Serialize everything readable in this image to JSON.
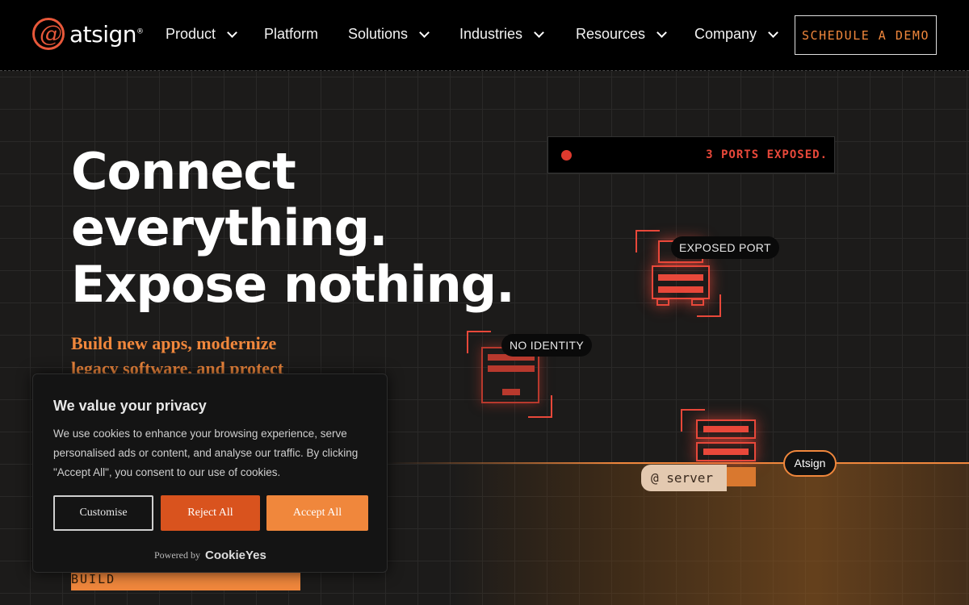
{
  "header": {
    "logo_text": "atsign",
    "logo_reg": "®",
    "nav": [
      {
        "label": "Product",
        "dropdown": true
      },
      {
        "label": "Platform",
        "dropdown": false
      },
      {
        "label": "Solutions",
        "dropdown": true
      },
      {
        "label": "Industries",
        "dropdown": true
      },
      {
        "label": "Resources",
        "dropdown": true
      },
      {
        "label": "Company",
        "dropdown": true
      }
    ],
    "cta": "SCHEDULE A DEMO"
  },
  "hero": {
    "title_lines": [
      "Connect",
      "everything.",
      "Expose nothing."
    ],
    "subtitle": "Build new apps, modernize legacy software, and protect",
    "cta": "EXPLORE WHAT YOU CAN BUILD"
  },
  "illustration": {
    "ports_status": "3 PORTS EXPOSED.",
    "exposed_port_label": "EXPOSED PORT",
    "no_identity_label": "NO IDENTITY",
    "atsign_label": "Atsign",
    "server_label": "@ server"
  },
  "cookie": {
    "title": "We value your privacy",
    "text": "We use cookies to enhance your browsing experience, serve personalised ads or content, and analyse our traffic. By clicking \"Accept All\", you consent to our use of cookies.",
    "customise": "Customise",
    "reject": "Reject All",
    "accept": "Accept All",
    "powered_by": "Powered by",
    "brand": "CookieYes"
  },
  "colors": {
    "accent": "#f0873c",
    "alert": "#e8483a",
    "reject": "#d9531e"
  }
}
